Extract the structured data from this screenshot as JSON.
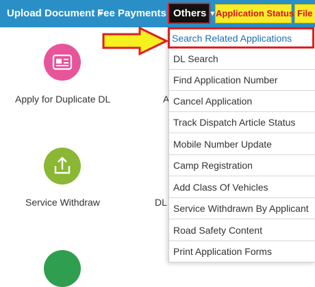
{
  "nav": {
    "upload": "Upload Document",
    "fee": "Fee Payments",
    "others": "Others",
    "status": "Application Status",
    "file": "File V"
  },
  "tiles": {
    "duplicate_dl": "Apply for Duplicate DL",
    "service_withdraw": "Service Withdraw",
    "partial_a": "A",
    "partial_dl": "DL"
  },
  "dropdown": {
    "items": [
      "Search Related Applications",
      "DL Search",
      "Find Application Number",
      "Cancel Application",
      "Track Dispatch Article Status",
      "Mobile Number Update",
      "Camp Registration",
      "Add Class Of Vehicles",
      "Service Withdrawn By Applicant",
      "Road Safety Content",
      "Print Application Forms"
    ]
  },
  "colors": {
    "navbar": "#2a8fc7",
    "highlight_red": "#e01e1e",
    "status_yellow": "#f7ec2b",
    "link_blue": "#1b6fb5",
    "pink_icon": "#e8549a",
    "green_icon": "#8ab734"
  }
}
